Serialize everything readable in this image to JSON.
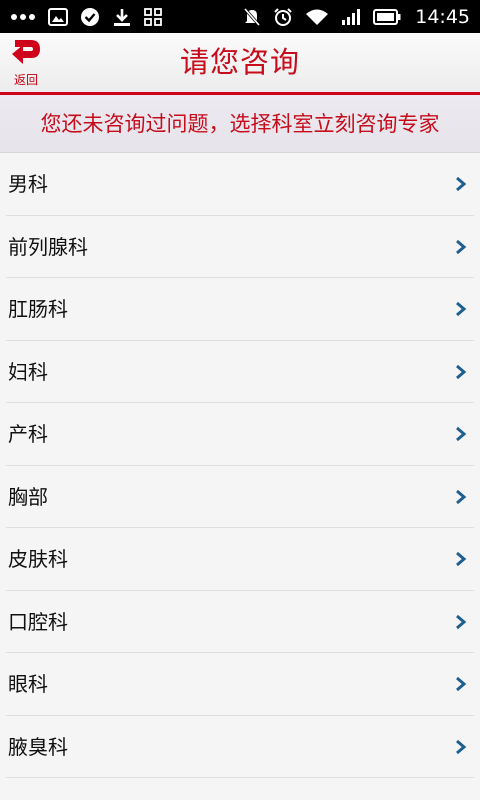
{
  "status_bar": {
    "time": "14:45",
    "icons": [
      "more-dots-icon",
      "image-icon",
      "check-circle-icon",
      "download-icon",
      "grid-icon",
      "mute-icon",
      "alarm-icon",
      "wifi-icon",
      "signal-icon",
      "battery-icon"
    ]
  },
  "header": {
    "title": "请您咨询",
    "back_label": "返回",
    "accent_color": "#c70c1c"
  },
  "notice": {
    "text": "您还未咨询过问题，选择科室立刻咨询专家"
  },
  "departments": [
    {
      "label": "男科"
    },
    {
      "label": "前列腺科"
    },
    {
      "label": "肛肠科"
    },
    {
      "label": "妇科"
    },
    {
      "label": "产科"
    },
    {
      "label": "胸部"
    },
    {
      "label": "皮肤科"
    },
    {
      "label": "口腔科"
    },
    {
      "label": "眼科"
    },
    {
      "label": "腋臭科"
    }
  ],
  "chevron_color": "#1f5f8f"
}
